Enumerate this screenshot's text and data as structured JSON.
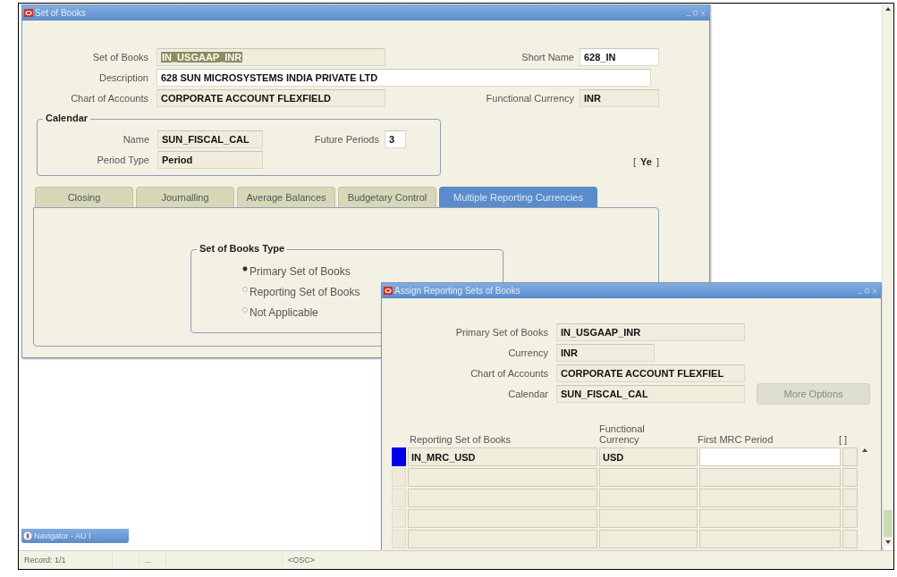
{
  "set_of_books_window": {
    "title": "Set of Books",
    "set_of_books": {
      "label": "Set of Books",
      "value": "IN_USGAAP_INR",
      "read_only": true,
      "text_selected": true
    },
    "short_name": {
      "label": "Short Name",
      "value": "628_IN",
      "read_only": false
    },
    "description": {
      "label": "Description",
      "value": "628 SUN MICROSYSTEMS INDIA PRIVATE LTD",
      "read_only": false
    },
    "chart_of_accounts": {
      "label": "Chart of Accounts",
      "value": "CORPORATE ACCOUNT FLEXFIELD",
      "read_only": true
    },
    "functional_currency": {
      "label": "Functional Currency",
      "value": "INR",
      "read_only": true
    },
    "calendar": {
      "title": "Calendar",
      "name": {
        "label": "Name",
        "value": "SUN_FISCAL_CAL",
        "read_only": true
      },
      "future_periods": {
        "label": "Future Periods",
        "value": "3",
        "read_only": false
      },
      "period_type": {
        "label": "Period Type",
        "value": "Period",
        "read_only": true
      }
    },
    "flag": {
      "open": "[",
      "value": "Ye",
      "close": "]"
    },
    "tabs": [
      {
        "label": "Closing",
        "selected": false
      },
      {
        "label": "Journalling",
        "selected": false
      },
      {
        "label": "Average Balances",
        "selected": false
      },
      {
        "label": "Budgetary Control",
        "selected": false
      },
      {
        "label": "Multiple Reporting Currencies",
        "selected": true
      }
    ],
    "set_of_books_type": {
      "title": "Set of Books Type",
      "options": [
        {
          "label": "Primary Set of Books",
          "selected": true
        },
        {
          "label": "Reporting Set of Books",
          "selected": false
        },
        {
          "label": "Not Applicable",
          "selected": false
        }
      ]
    }
  },
  "assign_window": {
    "title": "Assign Reporting Sets of Books",
    "fields": [
      {
        "label": "Primary Set of Books",
        "value": "IN_USGAAP_INR"
      },
      {
        "label": "Currency",
        "value": "INR"
      },
      {
        "label": "Chart of Accounts",
        "value": "CORPORATE ACCOUNT FLEXFIEL"
      },
      {
        "label": "Calendar",
        "value": "SUN_FISCAL_CAL"
      }
    ],
    "more_options_button": {
      "label": "More Options",
      "disabled": true
    },
    "table": {
      "columns": [
        "Reporting Set of Books",
        "Functional Currency",
        "First MRC Period",
        "[ ]"
      ],
      "rows": [
        {
          "reporting_set_of_books": "IN_MRC_USD",
          "functional_currency": "USD",
          "selected": true
        },
        {
          "selected": false
        },
        {
          "selected": false
        },
        {
          "selected": false
        },
        {
          "selected": false
        }
      ]
    }
  },
  "navigator": {
    "title": "Navigator - AU I"
  },
  "status_bar": {
    "record": "Record: 1/1",
    "field_2": "...",
    "mode": "<OSC>"
  }
}
